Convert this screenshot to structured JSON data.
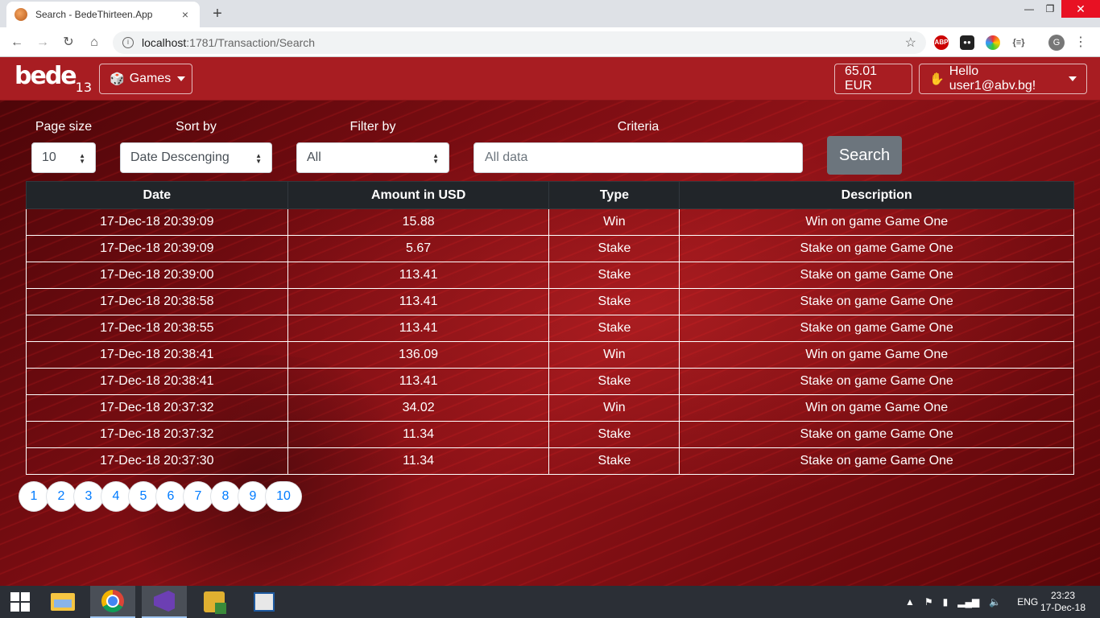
{
  "browser": {
    "tab_title": "Search - BedeThirteen.App",
    "tab_close": "×",
    "new_tab": "+",
    "url_host": "localhost",
    "url_path": ":1781/Transaction/Search",
    "window_min": "—",
    "window_max": "❐",
    "window_close": "✕",
    "ext_abp": "ABP",
    "profile_initial": "G"
  },
  "app": {
    "logo": "bede",
    "logo_sub": "13",
    "games_label": "Games",
    "balance": "65.01 EUR",
    "user_greeting": "Hello user1@abv.bg!",
    "brand_color": "#a81d22"
  },
  "filters": {
    "page_size_label": "Page size",
    "page_size_value": "10",
    "sort_label": "Sort by",
    "sort_value": "Date Descenging",
    "filter_label": "Filter by",
    "filter_value": "All",
    "criteria_label": "Criteria",
    "criteria_placeholder": "All data",
    "search_button": "Search"
  },
  "table": {
    "headers": [
      "Date",
      "Amount in USD",
      "Type",
      "Description"
    ],
    "rows": [
      [
        "17-Dec-18 20:39:09",
        "15.88",
        "Win",
        "Win on game Game One"
      ],
      [
        "17-Dec-18 20:39:09",
        "5.67",
        "Stake",
        "Stake on game Game One"
      ],
      [
        "17-Dec-18 20:39:00",
        "113.41",
        "Stake",
        "Stake on game Game One"
      ],
      [
        "17-Dec-18 20:38:58",
        "113.41",
        "Stake",
        "Stake on game Game One"
      ],
      [
        "17-Dec-18 20:38:55",
        "113.41",
        "Stake",
        "Stake on game Game One"
      ],
      [
        "17-Dec-18 20:38:41",
        "136.09",
        "Win",
        "Win on game Game One"
      ],
      [
        "17-Dec-18 20:38:41",
        "113.41",
        "Stake",
        "Stake on game Game One"
      ],
      [
        "17-Dec-18 20:37:32",
        "34.02",
        "Win",
        "Win on game Game One"
      ],
      [
        "17-Dec-18 20:37:32",
        "11.34",
        "Stake",
        "Stake on game Game One"
      ],
      [
        "17-Dec-18 20:37:30",
        "11.34",
        "Stake",
        "Stake on game Game One"
      ]
    ]
  },
  "pagination": [
    "1",
    "2",
    "3",
    "4",
    "5",
    "6",
    "7",
    "8",
    "9",
    "10"
  ],
  "taskbar": {
    "language": "ENG",
    "time": "23:23",
    "date": "17-Dec-18"
  }
}
